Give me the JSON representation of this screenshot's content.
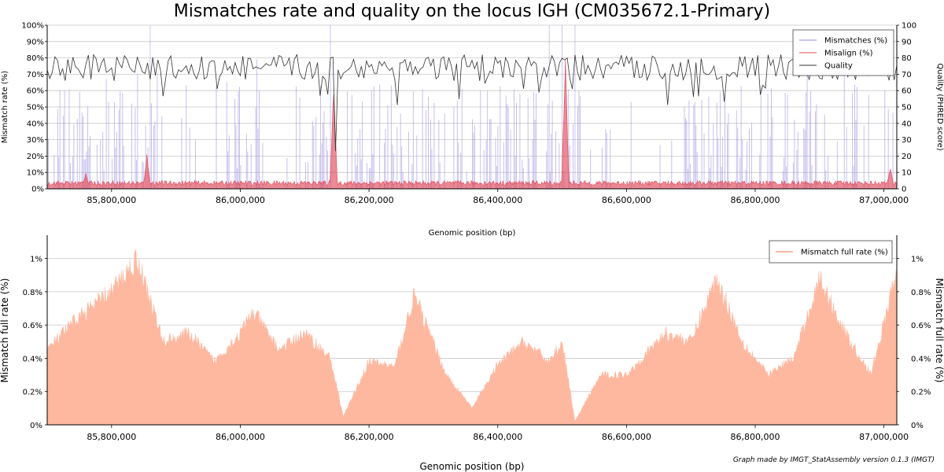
{
  "chart_data": [
    {
      "type": "line",
      "title": "Mismatches rate and quality on the locus IGH (CM035672.1-Primary)",
      "xlabel": "Genomic position (bp)",
      "ylabel": "Mismatch rate (%)",
      "y2label": "Quality (PHRED score)",
      "xlim": [
        85700000,
        87020000
      ],
      "ylim": [
        0,
        100
      ],
      "y2lim": [
        0,
        100
      ],
      "x_ticks": [
        "85,800,000",
        "86,000,000",
        "86,200,000",
        "86,400,000",
        "86,600,000",
        "86,800,000",
        "87,000,000"
      ],
      "y_ticks": [
        "0%",
        "10%",
        "20%",
        "30%",
        "40%",
        "50%",
        "60%",
        "70%",
        "80%",
        "90%",
        "100%"
      ],
      "y2_ticks": [
        "0",
        "10",
        "20",
        "30",
        "40",
        "50",
        "60",
        "70",
        "80",
        "90",
        "100"
      ],
      "grid": true,
      "legend": "top-right",
      "legend_entries": [
        "Mismatches (%)",
        "Misalign (%)",
        "Quality"
      ],
      "series_colors": {
        "mismatches": "#9b8fe0",
        "misalign": "#e04a5a",
        "quality": "#333333"
      },
      "misalign_peaks": [
        {
          "x": 85760000,
          "y": 10
        },
        {
          "x": 85855000,
          "y": 22
        },
        {
          "x": 86145000,
          "y": 66
        },
        {
          "x": 86505000,
          "y": 82
        },
        {
          "x": 87010000,
          "y": 14
        }
      ],
      "quality_mean": 74
    },
    {
      "type": "area",
      "xlabel": "Genomic position (bp)",
      "ylabel": "Mismatch full rate (%)",
      "xlim": [
        85700000,
        87020000
      ],
      "ylim": [
        0,
        1.14
      ],
      "x_ticks": [
        "85,800,000",
        "86,000,000",
        "86,200,000",
        "86,400,000",
        "86,600,000",
        "86,800,000",
        "87,000,000"
      ],
      "y_ticks": [
        "0%",
        "0.2%",
        "0.4%",
        "0.6%",
        "0.8%",
        "1%"
      ],
      "legend": "top-right",
      "legend_entries": [
        "Mismatch full rate (%)"
      ],
      "color": "#ffb8a0",
      "x": [
        85700000,
        85750000,
        85800000,
        85840000,
        85880000,
        85920000,
        85960000,
        86000000,
        86020000,
        86060000,
        86100000,
        86140000,
        86160000,
        86200000,
        86240000,
        86270000,
        86320000,
        86360000,
        86400000,
        86440000,
        86480000,
        86500000,
        86520000,
        86560000,
        86600000,
        86660000,
        86700000,
        86740000,
        86780000,
        86820000,
        86860000,
        86900000,
        86940000,
        86980000,
        87020000
      ],
      "values": [
        0.45,
        0.65,
        0.8,
        1.0,
        0.5,
        0.55,
        0.38,
        0.55,
        0.68,
        0.45,
        0.55,
        0.4,
        0.05,
        0.38,
        0.35,
        0.78,
        0.3,
        0.1,
        0.36,
        0.5,
        0.38,
        0.5,
        0.02,
        0.3,
        0.3,
        0.55,
        0.5,
        0.88,
        0.5,
        0.3,
        0.4,
        0.88,
        0.55,
        0.3,
        0.92
      ]
    }
  ],
  "credit": "Graph made by IMGT_StatAssembly version 0.1.3 (IMGT)"
}
